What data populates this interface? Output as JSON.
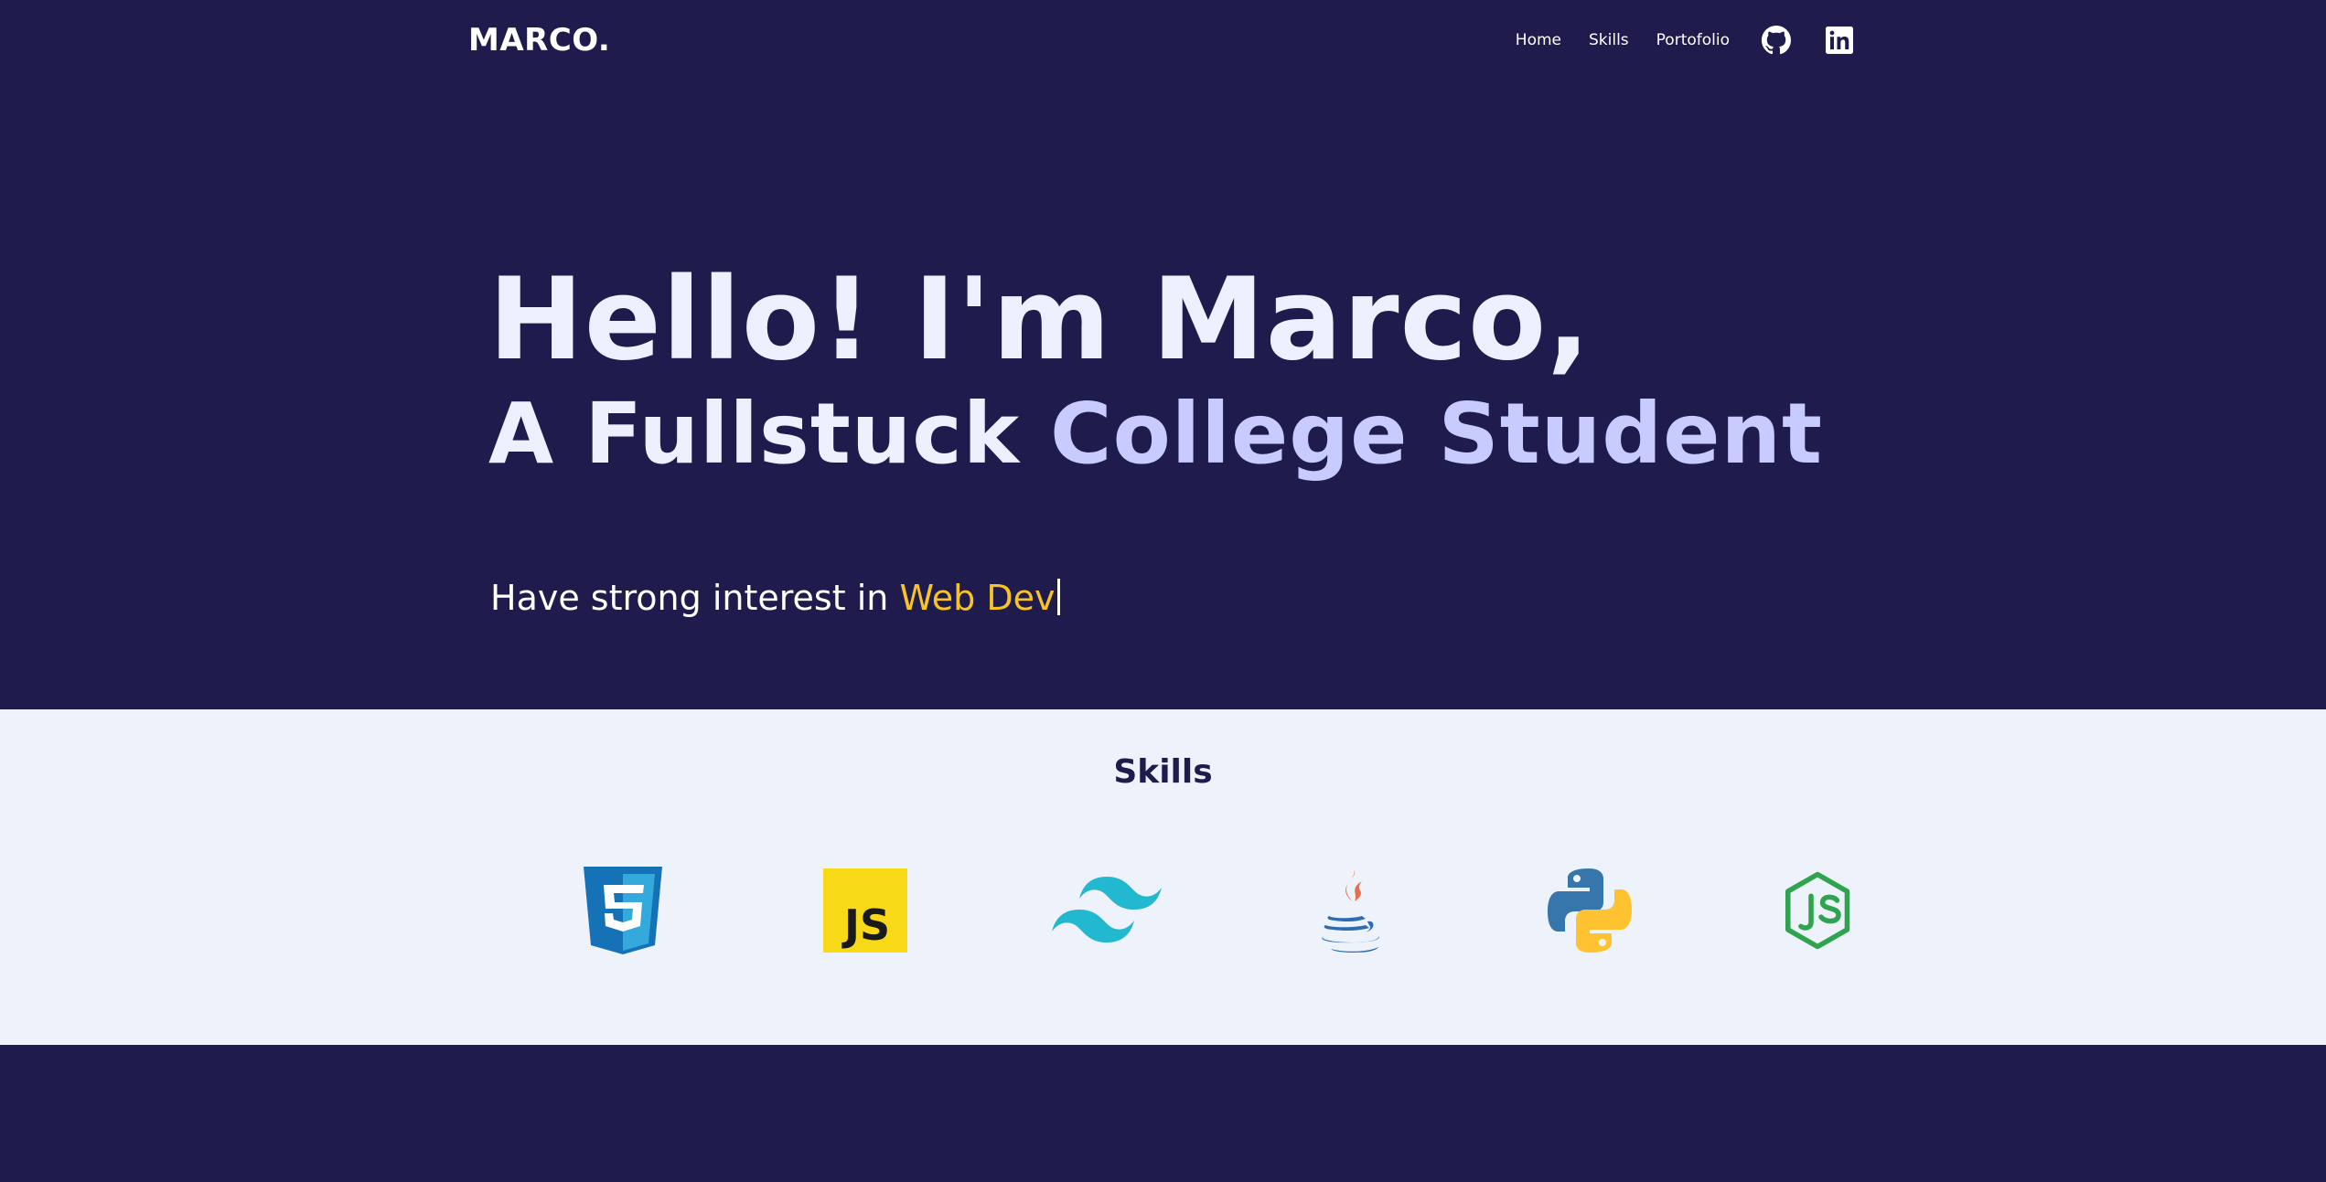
{
  "nav": {
    "logo": "MARCO.",
    "links": [
      "Home",
      "Skills",
      "Portofolio"
    ],
    "icons": [
      "github-icon",
      "linkedin-icon"
    ]
  },
  "hero": {
    "line1": "Hello! I'm Marco,",
    "line2_plain": "A Fullstuck",
    "line2_accent": "College Student",
    "sub_prefix": "Have strong interest in",
    "sub_highlight": "Web Dev"
  },
  "skills": {
    "title": "Skills",
    "icons": [
      "css3-icon",
      "javascript-icon",
      "tailwind-icon",
      "java-icon",
      "python-icon",
      "nodejs-icon"
    ],
    "js_badge_text": "JS"
  },
  "colors": {
    "background": "#1f1b4c",
    "accent": "#c7cbff",
    "highlight": "#f7c325",
    "skills_bg": "#eef2fb"
  }
}
